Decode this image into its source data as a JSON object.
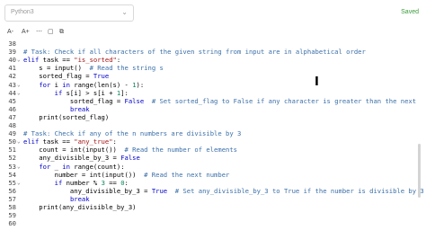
{
  "header": {
    "language_select": {
      "value": "Python3"
    },
    "status": "Saved"
  },
  "toolbar": {
    "font_down": "A-",
    "font_up": "A+",
    "items": [
      "⋯",
      "▢",
      "⧉"
    ]
  },
  "editor": {
    "lines": [
      {
        "n": "38",
        "code": ""
      },
      {
        "n": "39",
        "code": "# Task: Check if all characters of the given string from input are in alphabetical order"
      },
      {
        "n": "40",
        "code": "elif task == \"is_sorted\":"
      },
      {
        "n": "41",
        "code": "    s = input()  # Read the string s"
      },
      {
        "n": "42",
        "code": "    sorted_flag = True"
      },
      {
        "n": "43",
        "code": "    for i in range(len(s) - 1):"
      },
      {
        "n": "44",
        "code": "        if s[i] > s[i + 1]:"
      },
      {
        "n": "45",
        "code": "            sorted_flag = False  # Set sorted_flag to False if any character is greater than the next"
      },
      {
        "n": "46",
        "code": "            break"
      },
      {
        "n": "47",
        "code": "    print(sorted_flag)"
      },
      {
        "n": "48",
        "code": ""
      },
      {
        "n": "49",
        "code": "# Task: Check if any of the n numbers are divisible by 3"
      },
      {
        "n": "50",
        "code": "elif task == \"any_true\":"
      },
      {
        "n": "51",
        "code": "    count = int(input())  # Read the number of elements"
      },
      {
        "n": "52",
        "code": "    any_divisible_by_3 = False"
      },
      {
        "n": "53",
        "code": "    for _ in range(count):"
      },
      {
        "n": "54",
        "code": "        number = int(input())  # Read the next number"
      },
      {
        "n": "55",
        "code": "        if number % 3 == 0:"
      },
      {
        "n": "56",
        "code": "            any_divisible_by_3 = True  # Set any_divisible_by_3 to True if the number is divisible by 3"
      },
      {
        "n": "57",
        "code": "            break"
      },
      {
        "n": "58",
        "code": "    print(any_divisible_by_3)"
      },
      {
        "n": "59",
        "code": ""
      },
      {
        "n": "60",
        "code": ""
      }
    ]
  }
}
